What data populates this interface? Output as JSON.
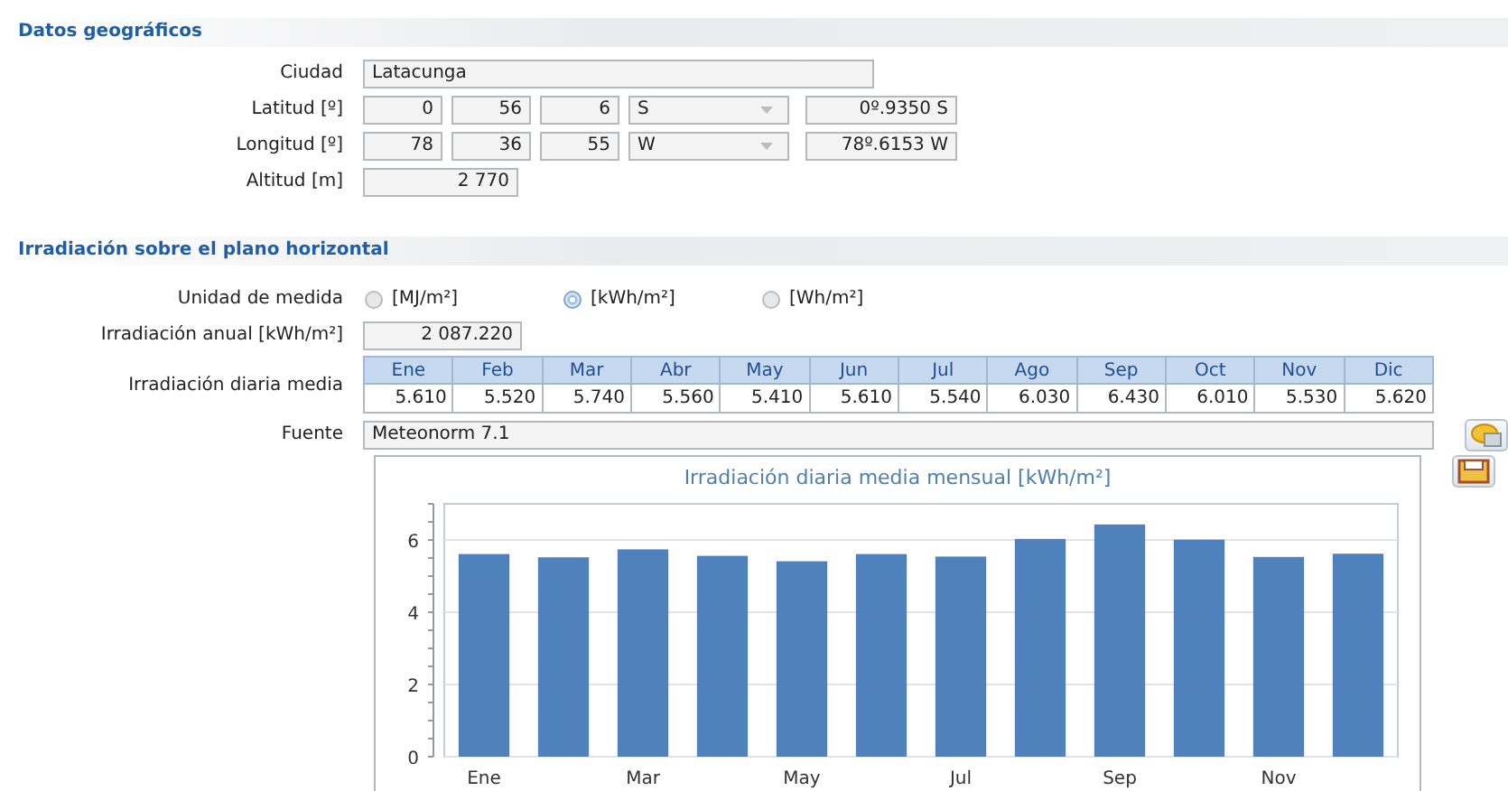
{
  "sections": [
    {
      "title": "Datos geográficos"
    },
    {
      "title": "Irradiación sobre el plano horizontal"
    }
  ],
  "geo": {
    "city_label": "Ciudad",
    "city": "Latacunga",
    "coords": [
      {
        "label": "Latitud [º]",
        "deg": "0",
        "min": "56",
        "sec": "6",
        "hemisphere": "S",
        "decimal": "0º.9350 S"
      },
      {
        "label": "Longitud [º]",
        "deg": "78",
        "min": "36",
        "sec": "55",
        "hemisphere": "W",
        "decimal": "78º.6153 W"
      }
    ],
    "altitude_label": "Altitud [m]",
    "altitude": "2 770"
  },
  "irradiation": {
    "unit_label": "Unidad de medida",
    "units": [
      {
        "label": "[MJ/m²]",
        "selected": false
      },
      {
        "label": "[kWh/m²]",
        "selected": true
      },
      {
        "label": "[Wh/m²]",
        "selected": false
      }
    ],
    "annual_label": "Irradiación anual [kWh/m²]",
    "annual": "2 087.220",
    "daily_label": "Irradiación diaria media",
    "months": [
      "Ene",
      "Feb",
      "Mar",
      "Abr",
      "May",
      "Jun",
      "Jul",
      "Ago",
      "Sep",
      "Oct",
      "Nov",
      "Dic"
    ],
    "daily": [
      "5.610",
      "5.520",
      "5.740",
      "5.560",
      "5.410",
      "5.610",
      "5.540",
      "6.030",
      "6.430",
      "6.010",
      "5.530",
      "5.620"
    ],
    "source_label": "Fuente",
    "source": "Meteonorm 7.1",
    "chart_data": {
      "type": "bar",
      "title": "Irradiación diaria media mensual [kWh/m²]",
      "categories": [
        "Ene",
        null,
        "Mar",
        null,
        "May",
        null,
        "Jul",
        null,
        "Sep",
        null,
        "Nov",
        null
      ],
      "series": [
        {
          "color": "#4f81bd",
          "values": [
            5.61,
            5.52,
            5.74,
            5.56,
            5.41,
            5.61,
            5.54,
            6.03,
            6.43,
            6.01,
            5.53,
            5.62
          ]
        }
      ],
      "ylim": [
        0,
        7
      ],
      "yticks": [
        0,
        2,
        4,
        6
      ],
      "grid": true
    }
  }
}
